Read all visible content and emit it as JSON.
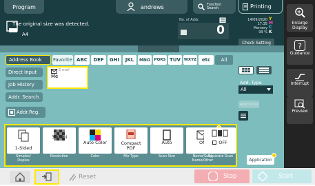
{
  "header": {
    "program": "Program",
    "user": "andrews",
    "function_search": "Function\nSearch",
    "printing": "Printing"
  },
  "status": {
    "message": "The original size was detected.",
    "paper_size": "A4",
    "num_of_addr_label": "No. of Addr.",
    "addr_count": "0",
    "datetime_line1": "14/09/2020",
    "datetime_line2": "17:35",
    "memory_label": "Memory",
    "memory_value": "99 %",
    "toner": [
      "Y",
      "M",
      "C",
      "K"
    ],
    "check_setting": "Check Setting"
  },
  "address": {
    "left_buttons": {
      "address_book": "Address Book",
      "direct_input": "Direct Input",
      "job_history": "Job History",
      "addr_search": "Addr. Search",
      "addr_reg": "Addr.Reg."
    },
    "tabs": [
      "Favorite",
      "ABC",
      "DEF",
      "GHI",
      "JKL",
      "MNO",
      "PQRS",
      "TUV",
      "WXYZ",
      "etc",
      "All"
    ],
    "entry": {
      "type": "E-mail",
      "name": "Me"
    },
    "addr_type_label": "Add. Type",
    "addr_type_value": "All",
    "addr_detail": "Addr.Detail"
  },
  "settings": [
    {
      "value": "1-Sided",
      "label": "Simplex/\nDuplex"
    },
    {
      "value": "300dpi",
      "label": "Resolution"
    },
    {
      "value": "Auto Color",
      "label": "Color"
    },
    {
      "value": "Compact\nPDF",
      "label": "File Type"
    },
    {
      "value": "Auto",
      "label": "Scan Size"
    },
    {
      "value": "ON",
      "label": "Name/Subj.\nName/Other"
    },
    {
      "value": "OFF",
      "label": "Separate Scan"
    }
  ],
  "application": "Application",
  "bottom": {
    "reset": "Reset",
    "stop": "Stop",
    "start": "Start"
  },
  "right_panel": {
    "enlarge": "Enlarge\nDisplay",
    "guidance": "Guidance",
    "interrupt": "Interrupt",
    "preview": "Preview"
  },
  "colors": {
    "dark_bg": "#1a3d41",
    "teal_panel": "#7dbdbd",
    "highlight": "#ffe800",
    "stop": "#f2aeb3",
    "start": "#c2e8ea"
  }
}
